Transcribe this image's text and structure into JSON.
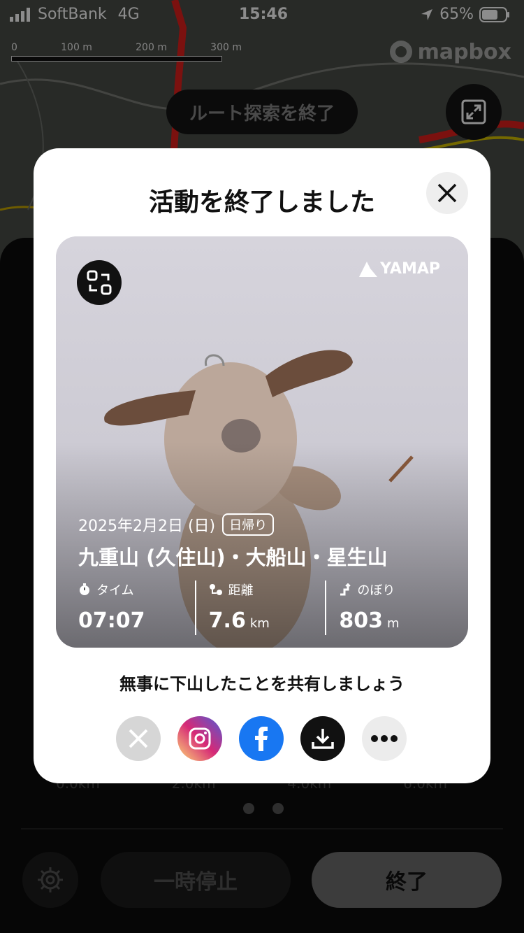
{
  "status_bar": {
    "carrier": "SoftBank",
    "network": "4G",
    "time": "15:46",
    "battery": "65%"
  },
  "map": {
    "scale_labels": [
      "0",
      "100 m",
      "200 m",
      "300 m"
    ],
    "attribution": "mapbox",
    "route_button": "ルート探索を終了",
    "expand_icon": "expand-icon"
  },
  "panel": {
    "km_labels": [
      "0.0km",
      "2.0km",
      "4.0km",
      "6.0km"
    ],
    "pause_label": "一時停止",
    "end_label": "終了"
  },
  "modal": {
    "title": "活動を終了しました",
    "card": {
      "brand": "YAMAP",
      "date": "2025年2月2日 (日)",
      "trip_type": "日帰り",
      "mountains": "九重山 (久住山)・大船山・星生山",
      "stats": [
        {
          "label": "タイム",
          "value": "07:07",
          "unit": "",
          "icon": "stopwatch-icon"
        },
        {
          "label": "距離",
          "value": "7.6",
          "unit": "km",
          "icon": "distance-icon"
        },
        {
          "label": "のぼり",
          "value": "803",
          "unit": "m",
          "icon": "ascent-icon"
        }
      ]
    },
    "share_prompt": "無事に下山したことを共有しましょう",
    "share_targets": [
      "X",
      "Instagram",
      "Facebook",
      "download",
      "more"
    ]
  },
  "colors": {
    "facebook": "#1877F2",
    "instagram_a": "#FEDA75",
    "instagram_b": "#D62976",
    "instagram_c": "#4F5BD5"
  }
}
